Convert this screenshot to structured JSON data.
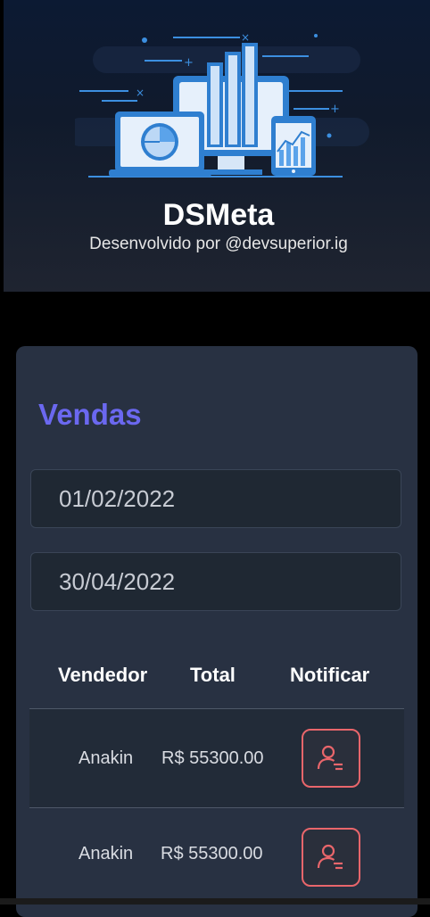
{
  "header": {
    "title": "DSMeta",
    "subtitle": "Desenvolvido por @devsuperior.ig",
    "hero_icon": "analytics-devices-illustration"
  },
  "sales": {
    "title": "Vendas",
    "min_date": "01/02/2022",
    "max_date": "30/04/2022",
    "columns": [
      "Vendedor",
      "Total",
      "Notificar"
    ],
    "rows": [
      {
        "seller": "Anakin",
        "total": "R$ 55300.00",
        "icon": "notify-user-icon"
      },
      {
        "seller": "Anakin",
        "total": "R$ 55300.00",
        "icon": "notify-user-icon"
      }
    ]
  },
  "colors": {
    "accent": "#6b68f0",
    "notify": "#e9666b",
    "card": "#283142"
  }
}
